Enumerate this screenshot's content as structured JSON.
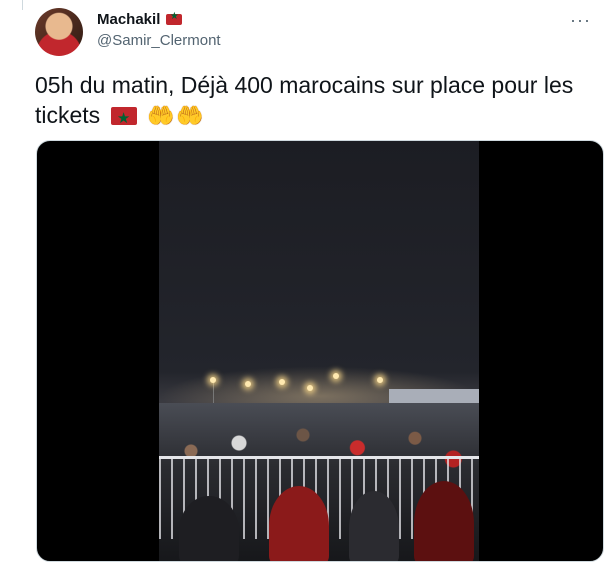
{
  "author": {
    "display_name": "Machakil",
    "handle": "@Samir_Clermont"
  },
  "menu": {
    "more_label": "···"
  },
  "tweet": {
    "text": "05h du matin, Déjà 400 marocains sur place pour les tickets",
    "emoji_hands": "🫶🫶"
  },
  "colors": {
    "flag_red": "#c1272d",
    "flag_green": "#006233",
    "handle_gray": "#536471"
  },
  "icons": [
    "morocco-flag-icon",
    "palms-up-together-icon",
    "more-options-icon"
  ]
}
